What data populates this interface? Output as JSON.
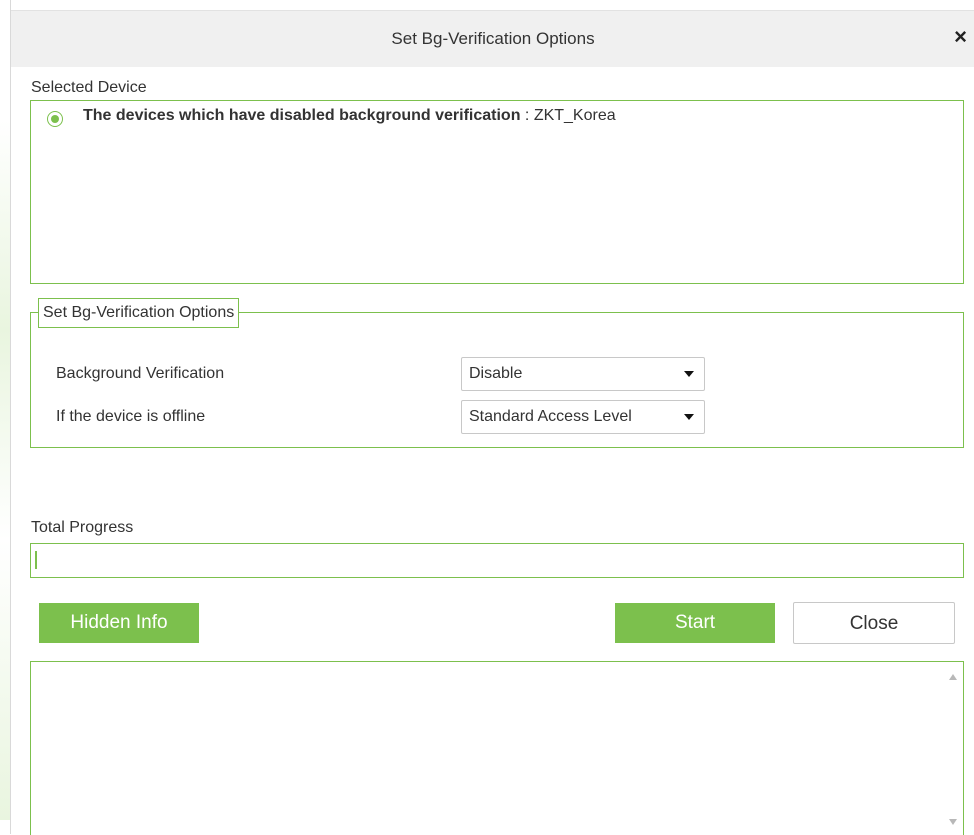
{
  "dialog": {
    "title": "Set Bg-Verification Options",
    "close_icon": "×"
  },
  "selected_device": {
    "label": "Selected Device",
    "device_prefix": "The devices which have disabled background verification",
    "device_separator": " : ",
    "device_name": "ZKT_Korea"
  },
  "options": {
    "legend": "Set Bg-Verification Options",
    "background_verification_label": "Background Verification",
    "background_verification_value": "Disable",
    "offline_label": "If the device is offline",
    "offline_value": "Standard Access Level"
  },
  "progress": {
    "label": "Total Progress",
    "fraction": 0.0
  },
  "buttons": {
    "hidden_info": "Hidden Info",
    "start": "Start",
    "close": "Close"
  },
  "colors": {
    "accent": "#7cc04d",
    "titlebar": "#f0f0f0"
  }
}
